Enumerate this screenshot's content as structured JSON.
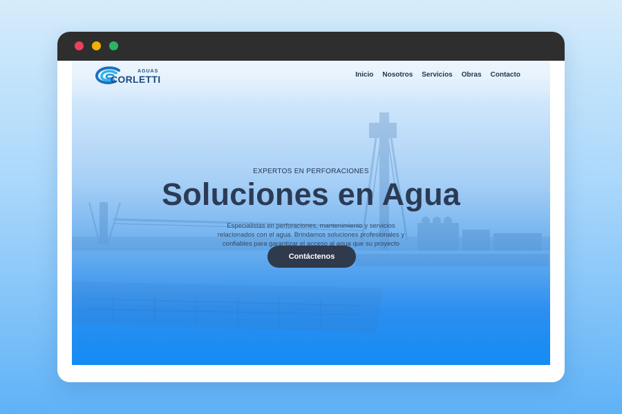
{
  "window": {
    "controls": [
      "close",
      "minimize",
      "maximize"
    ],
    "colors": {
      "close": "#ec3f5a",
      "minimize": "#f1b000",
      "maximize": "#2eb36a",
      "titlebar": "#2e2e2e"
    }
  },
  "logo": {
    "small_text": "AGUAS",
    "main_text": "CORLETTI"
  },
  "nav": {
    "items": [
      {
        "label": "Inicio"
      },
      {
        "label": "Nosotros"
      },
      {
        "label": "Servicios"
      },
      {
        "label": "Obras"
      },
      {
        "label": "Contacto"
      }
    ]
  },
  "hero": {
    "eyebrow": "EXPERTOS EN PERFORACIONES",
    "title": "Soluciones en Agua",
    "description": "Especialistas en perforaciones, mantenimiento y servicios relacionados con el agua. Brindamos soluciones profesionales y confiables para garantizar el acceso al agua que su proyecto necesita.",
    "cta_label": "Contáctenos"
  },
  "theme": {
    "accent": "#148bf5",
    "text_dark": "#2c3b55",
    "button": "#2f3a4c"
  }
}
